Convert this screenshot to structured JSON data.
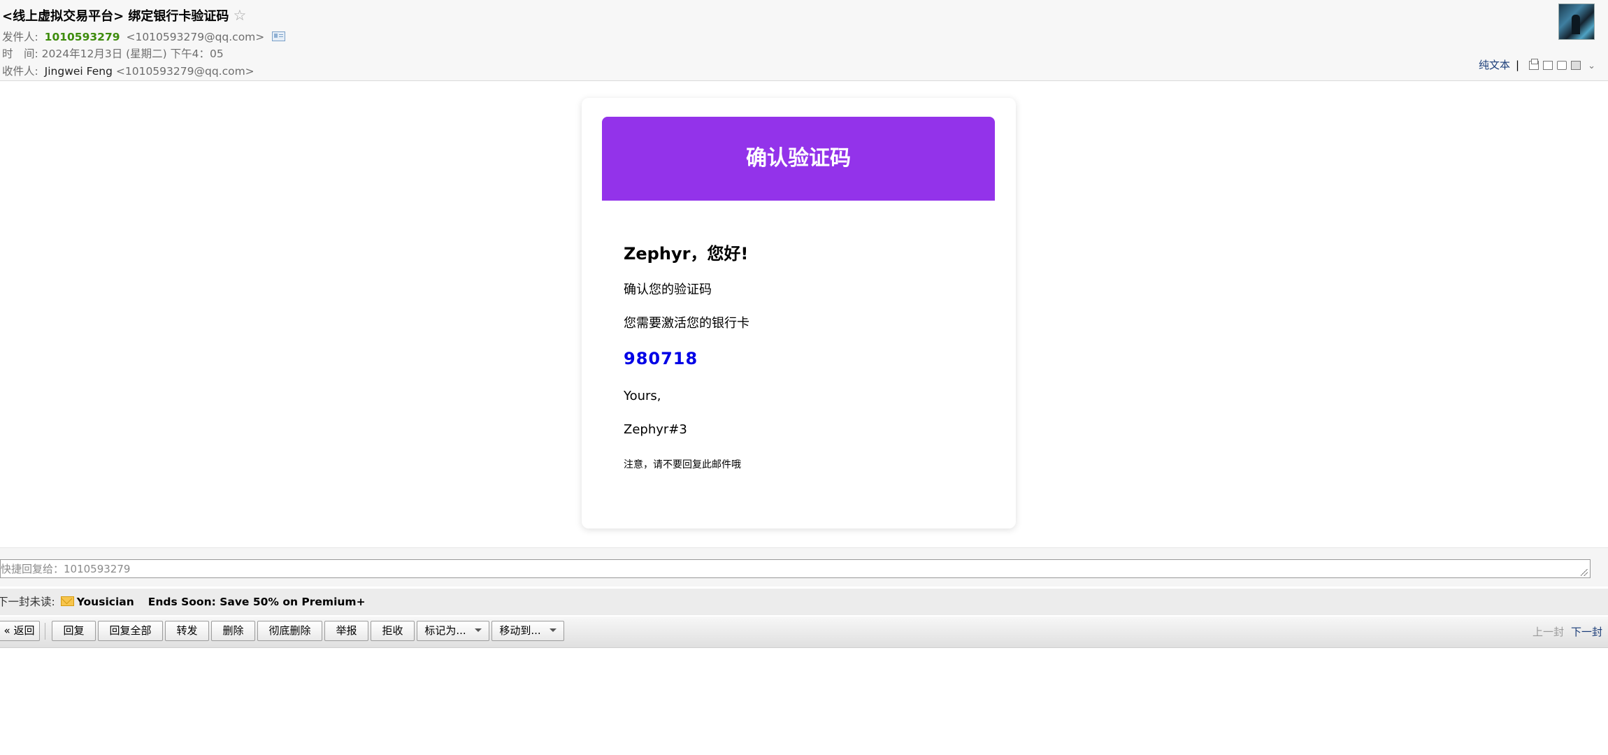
{
  "header": {
    "subject": "<线上虚拟交易平台> 绑定银行卡验证码",
    "sender_label": "发件人:",
    "sender_name": "1010593279",
    "sender_email": "<1010593279@qq.com>",
    "time_label": "时　间:",
    "time_value": "2024年12月3日 (星期二) 下午4：05",
    "recipient_label": "收件人:",
    "recipient_name": "Jingwei Feng",
    "recipient_email": "<1010593279@qq.com>",
    "plain_text": "纯文本",
    "separator": "|"
  },
  "email": {
    "banner_title": "确认验证码",
    "greeting": "Zephyr，您好!",
    "line1": "确认您的验证码",
    "line2": "您需要激活您的银行卡",
    "code": "980718",
    "closing": "Yours,",
    "signature": "Zephyr#3",
    "note": "注意，请不要回复此邮件哦",
    "banner_color": "#9333ea",
    "code_color": "#0000e6"
  },
  "quick_reply": {
    "placeholder": "快捷回复给：1010593279"
  },
  "next_unread": {
    "label": "下一封未读:",
    "sender": "Yousician",
    "subject": "Ends Soon: Save 50% on Premium+"
  },
  "toolbar": {
    "back": "« 返回",
    "reply": "回复",
    "reply_all": "回复全部",
    "forward": "转发",
    "delete": "删除",
    "delete_permanent": "彻底删除",
    "report": "举报",
    "reject": "拒收",
    "mark_as": "标记为...",
    "move_to": "移动到...",
    "prev_mail": "上一封",
    "next_mail": "下一封"
  },
  "icons": {
    "star": "star-icon",
    "vcard": "contact-card-icon",
    "avatar": "avatar",
    "envelope": "envelope-icon"
  }
}
